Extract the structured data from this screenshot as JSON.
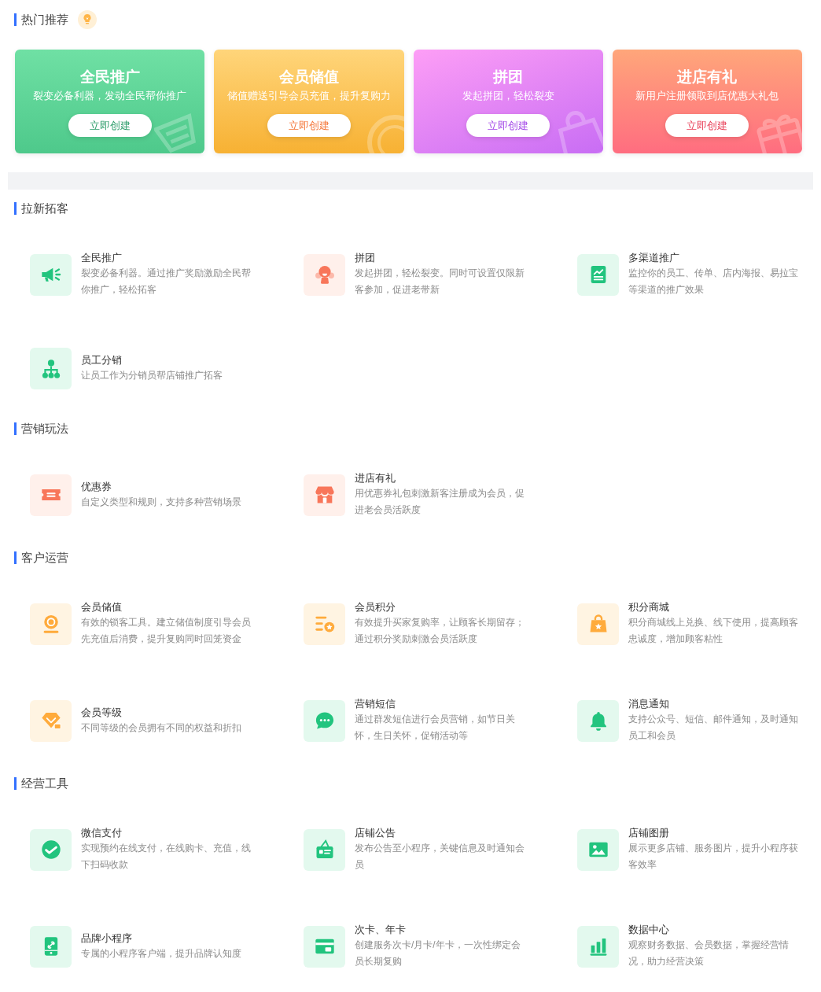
{
  "hot": {
    "title": "热门推荐",
    "cards": [
      {
        "title": "全民推广",
        "subtitle": "裂变必备利器，发动全民帮你推广",
        "button": "立即创建"
      },
      {
        "title": "会员储值",
        "subtitle": "储值赠送引导会员充值，提升复购力",
        "button": "立即创建"
      },
      {
        "title": "拼团",
        "subtitle": "发起拼团，轻松裂变",
        "button": "立即创建"
      },
      {
        "title": "进店有礼",
        "subtitle": "新用户注册领取到店优惠大礼包",
        "button": "立即创建"
      }
    ]
  },
  "sections": [
    {
      "title": "拉新拓客",
      "items": [
        {
          "title": "全民推广",
          "description": "裂变必备利器。通过推广奖励激励全民帮你推广，轻松拓客"
        },
        {
          "title": "拼团",
          "description": "发起拼团，轻松裂变。同时可设置仅限新客参加，促进老带新"
        },
        {
          "title": "多渠道推广",
          "description": "监控你的员工、传单、店内海报、易拉宝等渠道的推广效果"
        },
        {
          "title": "员工分销",
          "description": "让员工作为分销员帮店铺推广拓客"
        }
      ]
    },
    {
      "title": "营销玩法",
      "items": [
        {
          "title": "优惠券",
          "description": "自定义类型和规则，支持多种营销场景"
        },
        {
          "title": "进店有礼",
          "description": "用优惠券礼包刺激新客注册成为会员，促进老会员活跃度"
        }
      ]
    },
    {
      "title": "客户运营",
      "items": [
        {
          "title": "会员储值",
          "description": "有效的锁客工具。建立储值制度引导会员先充值后消费，提升复购同时回笼资金"
        },
        {
          "title": "会员积分",
          "description": "有效提升买家复购率，让顾客长期留存；通过积分奖励刺激会员活跃度"
        },
        {
          "title": "积分商城",
          "description": "积分商城线上兑换、线下使用，提高顾客忠诚度，增加顾客粘性"
        },
        {
          "title": "会员等级",
          "description": "不同等级的会员拥有不同的权益和折扣"
        },
        {
          "title": "营销短信",
          "description": "通过群发短信进行会员营销，如节日关怀，生日关怀，促销活动等"
        },
        {
          "title": "消息通知",
          "description": "支持公众号、短信、邮件通知，及时通知员工和会员"
        }
      ]
    },
    {
      "title": "经营工具",
      "items": [
        {
          "title": "微信支付",
          "description": "实现预约在线支付，在线购卡、充值，线下扫码收款"
        },
        {
          "title": "店铺公告",
          "description": "发布公告至小程序，关键信息及时通知会员"
        },
        {
          "title": "店铺图册",
          "description": "展示更多店铺、服务图片，提升小程序获客效率"
        },
        {
          "title": "品牌小程序",
          "description": "专属的小程序客户端，提升品牌认知度"
        },
        {
          "title": "次卡、年卡",
          "description": "创建服务次卡/月卡/年卡，一次性绑定会员长期复购"
        },
        {
          "title": "数据中心",
          "description": "观察财务数据、会员数据，掌握经营情况，助力经营决策"
        }
      ]
    }
  ]
}
